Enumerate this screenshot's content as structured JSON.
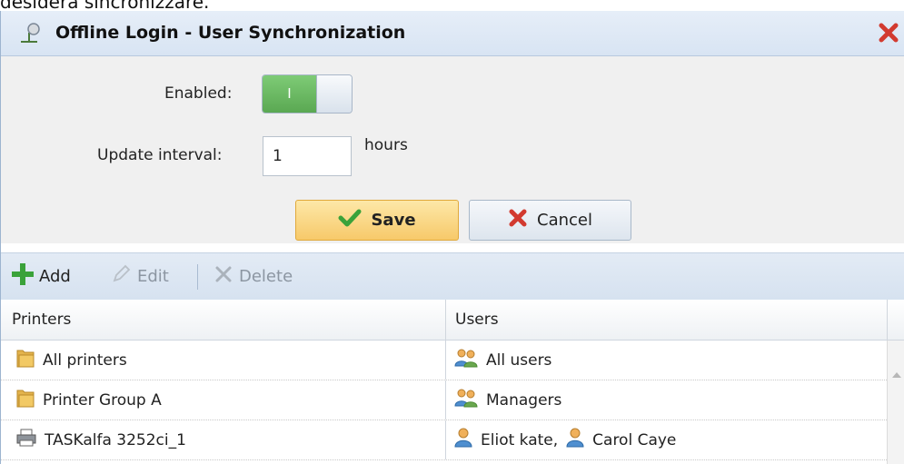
{
  "page_top_text": "desidera sincronizzare.",
  "dialog": {
    "title": "Offline Login - User Synchronization",
    "icons": {
      "title": "network-icon",
      "close": "close-icon"
    }
  },
  "form": {
    "enabled_label": "Enabled:",
    "toggle_on_text": "I",
    "enabled": true,
    "interval_label": "Update interval:",
    "interval_value": "1",
    "interval_unit": "hours"
  },
  "buttons": {
    "save": "Save",
    "cancel": "Cancel"
  },
  "toolbar": {
    "add": "Add",
    "edit": "Edit",
    "delete": "Delete"
  },
  "grid": {
    "columns": [
      "Printers",
      "Users"
    ],
    "rows": [
      {
        "printer": "All printers",
        "printer_icon": "folder-icon",
        "users": [
          {
            "name": "All users",
            "icon": "group-icon"
          }
        ]
      },
      {
        "printer": "Printer Group A",
        "printer_icon": "folder-icon",
        "users": [
          {
            "name": "Managers",
            "icon": "group-icon"
          }
        ]
      },
      {
        "printer": "TASKalfa 3252ci_1",
        "printer_icon": "printer-icon",
        "users": [
          {
            "name": "Eliot kate,",
            "icon": "user-icon"
          },
          {
            "name": "Carol Caye",
            "icon": "user-icon"
          }
        ]
      }
    ]
  },
  "colors": {
    "accent_green": "#5aa852",
    "save_yellow": "#f7c96a",
    "toolbar_blue": "#d6e2f0",
    "close_red": "#d23a2f"
  }
}
